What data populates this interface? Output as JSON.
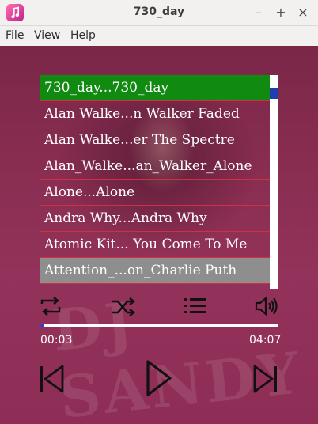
{
  "window": {
    "title": "730_day"
  },
  "menu": {
    "file": "File",
    "view": "View",
    "help": "Help"
  },
  "playlist": [
    {
      "label": "730_day...730_day",
      "state": "playing"
    },
    {
      "label": "Alan Walke...n Walker Faded",
      "state": ""
    },
    {
      "label": "Alan Walke...er The Spectre",
      "state": ""
    },
    {
      "label": "Alan_Walke...an_Walker_Alone",
      "state": ""
    },
    {
      "label": "Alone...Alone",
      "state": ""
    },
    {
      "label": "Andra Why...Andra Why",
      "state": ""
    },
    {
      "label": "Atomic Kit... You Come To Me",
      "state": ""
    },
    {
      "label": "Attention_...on_Charlie Puth",
      "state": "selected"
    }
  ],
  "player": {
    "elapsed": "00:03",
    "duration": "04:07",
    "progress": 0.012
  },
  "colors": {
    "playing_row": "#118a11",
    "selected_row": "#8e8e8e",
    "row_divider": "#d03040",
    "progress_fill": "#2a3fcf",
    "scroll_thumb": "#1f3fb0"
  },
  "icons": {
    "app": "music-note-icon",
    "repeat": "repeat-icon",
    "shuffle": "shuffle-icon",
    "playlist": "list-icon",
    "volume": "volume-icon",
    "previous": "skip-previous-icon",
    "play": "play-icon",
    "next": "skip-next-icon"
  }
}
